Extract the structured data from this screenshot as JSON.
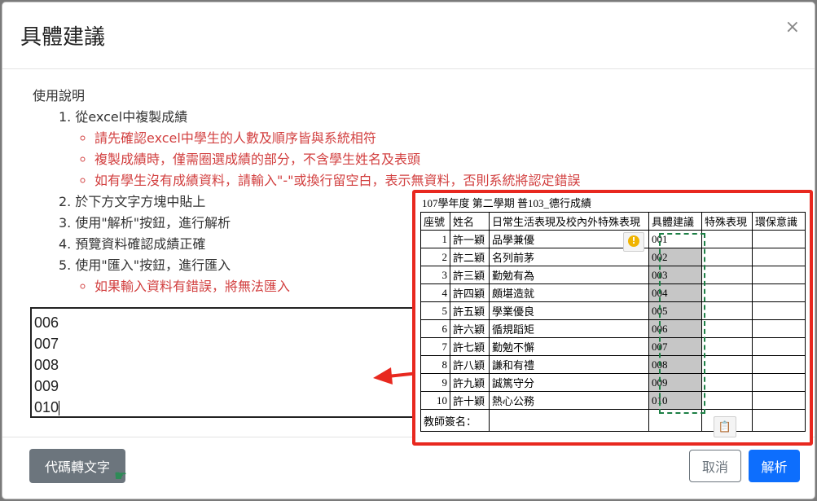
{
  "dialog": {
    "title": "具體建議",
    "close_symbol": "×"
  },
  "instructions": {
    "heading": "使用說明",
    "steps": [
      "1. 從excel中複製成績",
      "2. 於下方文字方塊中貼上",
      "3. 使用\"解析\"按鈕，進行解析",
      "4. 預覽資料確認成績正確",
      "5. 使用\"匯入\"按鈕，進行匯入"
    ],
    "step1_notes": [
      "請先確認excel中學生的人數及順序皆與系統相符",
      "複製成績時，僅需圈選成績的部分，不含學生姓名及表頭",
      "如有學生沒有成績資料，請輸入\"-\"或換行留空白，表示無資料，否則系統將認定錯誤"
    ],
    "step5_notes": [
      "如果輸入資料有錯誤，將無法匯入"
    ]
  },
  "paste_box": {
    "lines": [
      "006",
      "007",
      "008",
      "009",
      "010"
    ]
  },
  "footer": {
    "convert_label": "代碼轉文字",
    "cancel_label": "取消",
    "parse_label": "解析"
  },
  "spreadsheet": {
    "title": "107學年度 第二學期 普103_德行成績",
    "headers": [
      "座號",
      "姓名",
      "日常生活表現及校內外特殊表現",
      "具體建議",
      "特殊表現",
      "環保意識"
    ],
    "rows": [
      {
        "seat": "1",
        "name": "許一穎",
        "desc": "品學兼優",
        "adv": "001"
      },
      {
        "seat": "2",
        "name": "許二穎",
        "desc": "名列前茅",
        "adv": "002"
      },
      {
        "seat": "3",
        "name": "許三穎",
        "desc": "勤勉有為",
        "adv": "003"
      },
      {
        "seat": "4",
        "name": "許四穎",
        "desc": "頗堪造就",
        "adv": "004"
      },
      {
        "seat": "5",
        "name": "許五穎",
        "desc": "學業優良",
        "adv": "005"
      },
      {
        "seat": "6",
        "name": "許六穎",
        "desc": "循規蹈矩",
        "adv": "006"
      },
      {
        "seat": "7",
        "name": "許七穎",
        "desc": "勤勉不懈",
        "adv": "007"
      },
      {
        "seat": "8",
        "name": "許八穎",
        "desc": "謙和有禮",
        "adv": "008"
      },
      {
        "seat": "9",
        "name": "許九穎",
        "desc": "誠篤守分",
        "adv": "009"
      },
      {
        "seat": "10",
        "name": "許十穎",
        "desc": "熱心公務",
        "adv": "010"
      }
    ],
    "signature_label": "教師簽名：",
    "warning_symbol": "!",
    "annotation_color": "#e8281f"
  }
}
